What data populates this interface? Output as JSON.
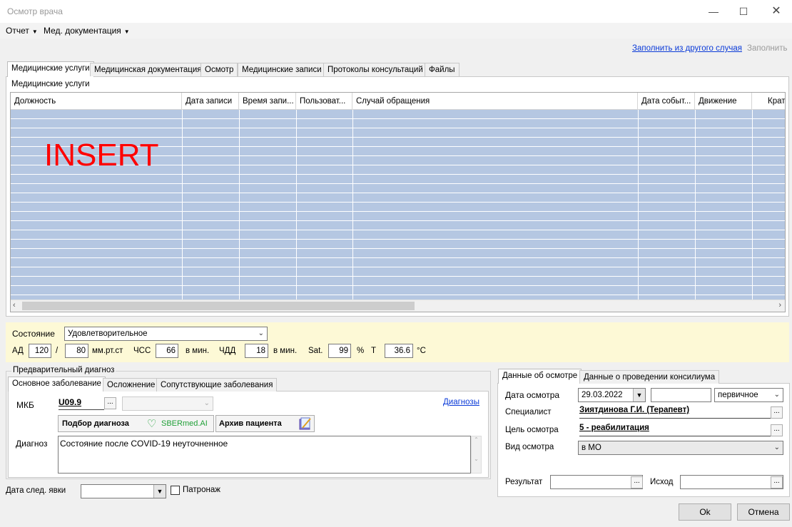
{
  "window": {
    "title": "Осмотр врача",
    "controls": [
      "minimize-icon",
      "maximize-icon",
      "close-icon"
    ]
  },
  "menu": {
    "report": "Отчет",
    "meddocs": "Мед. документация"
  },
  "toplinks": {
    "fill_from_other": "Заполнить из другого случая",
    "fill": "Заполнить"
  },
  "tabs": [
    "Медицинские услуги",
    "Медицинская документация",
    "Осмотр",
    "Медицинские записи",
    "Протоколы консультаций",
    "Файлы"
  ],
  "services": {
    "label": "Медицинские услуги",
    "columns": [
      "Должность",
      "Дата записи",
      "Время запи...",
      "Пользоват...",
      "Случай обращения",
      "Дата событ...",
      "Движение",
      "Кратк"
    ],
    "overlay": "INSERT"
  },
  "vitals": {
    "state_label": "Состояние",
    "state_value": "Удовлетворительное",
    "bp_label": "АД",
    "bp_sys": "120",
    "bp_sep": "/",
    "bp_dia": "80",
    "bp_unit": "мм.рт.ст",
    "hr_label": "ЧСС",
    "hr_value": "66",
    "hr_unit": "в мин.",
    "rr_label": "ЧДД",
    "rr_value": "18",
    "rr_unit": "в мин.",
    "sat_label": "Sat.",
    "sat_value": "99",
    "sat_unit": "%",
    "t_label": "T",
    "t_value": "36.6",
    "t_unit": "°C"
  },
  "diagnosis": {
    "group_title": "Предварительный диагноз",
    "tabs": [
      "Основное заболевание",
      "Осложнение",
      "Сопутствующие заболевания"
    ],
    "mkb_label": "МКБ",
    "mkb_value": "U09.9",
    "diagnoses_link": "Диагнозы",
    "pick_button": "Подбор диагноза",
    "sber_logo": "SBERmed.AI",
    "archive_button": "Архив пациента",
    "diag_label": "Диагноз",
    "diag_text": "Состояние после COVID-19 неуточненное"
  },
  "next_visit": {
    "label": "Дата след. явки",
    "patronage": "Патронаж"
  },
  "exam": {
    "tabs": [
      "Данные об осмотре",
      "Данные о проведении консилиума"
    ],
    "date_label": "Дата осмотра",
    "date_value": "29.03.2022",
    "type_value": "первичное",
    "specialist_label": "Специалист",
    "specialist_value": "Зиятдинова Г.И. (Терапевт)",
    "goal_label": "Цель осмотра",
    "goal_value": "5 - реабилитация",
    "kind_label": "Вид осмотра",
    "kind_value": "в МО",
    "result_label": "Результат",
    "outcome_label": "Исход"
  },
  "buttons": {
    "ok": "Ok",
    "cancel": "Отмена"
  }
}
